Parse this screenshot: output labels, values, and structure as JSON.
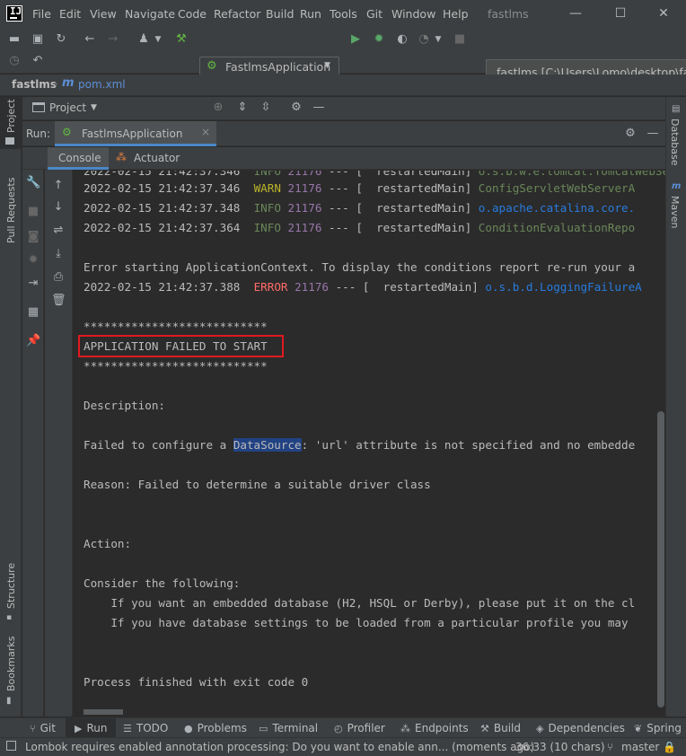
{
  "menubar": {
    "logo": "IJ",
    "items": [
      "File",
      "Edit",
      "View",
      "Navigate",
      "Code",
      "Refactor",
      "Build",
      "Run",
      "Tools",
      "Git",
      "Window",
      "Help"
    ],
    "title": "fastlms"
  },
  "toolbar": {
    "run_config": "FastlmsApplication",
    "tooltip": "fastlms [C:\\Users\\Lomo\\desktop\\fastlms"
  },
  "breadcrumb": {
    "project": "fastlms",
    "file_icon": "m",
    "file": "pom.xml"
  },
  "left_stripe": {
    "project": "Project",
    "pull_requests": "Pull Requests",
    "structure": "Structure",
    "bookmarks": "Bookmarks"
  },
  "right_stripe": {
    "database": "Database",
    "maven": "Maven"
  },
  "project_panel": {
    "label": "Project"
  },
  "run_panel": {
    "label": "Run:",
    "tab": "FastlmsApplication",
    "close": "×",
    "console_tab": "Console",
    "actuator_tab": "Actuator"
  },
  "console": {
    "partial_line": {
      "ts": "2022-02-15 21:42:37.346",
      "level": " INFO ",
      "pid": "21176",
      "sep": " --- [  restartedMain] ",
      "logger": "o.s.b.w.e.tomcat.TomcatWebServer"
    },
    "log_lines": [
      {
        "ts": "2022-02-15 21:42:37.346",
        "level": " WARN ",
        "pid": "21176",
        "sep": " --- [  restartedMain] ",
        "logger": "ConfigServletWebServerA"
      },
      {
        "ts": "2022-02-15 21:42:37.348",
        "level": " INFO ",
        "pid": "21176",
        "sep": " --- [  restartedMain] ",
        "logger": "o.apache.catalina.core."
      },
      {
        "ts": "2022-02-15 21:42:37.364",
        "level": " INFO ",
        "pid": "21176",
        "sep": " --- [  restartedMain] ",
        "logger": "ConditionEvaluationRepo"
      }
    ],
    "error_starting": "Error starting ApplicationContext. To display the conditions report re-run your a",
    "error_line": {
      "ts": "2022-02-15 21:42:37.388",
      "level": " ERROR ",
      "pid": "21176",
      "sep": " --- [  restartedMain] ",
      "logger": "o.s.b.d.LoggingFailureA"
    },
    "stars": "***************************",
    "failed": "APPLICATION FAILED TO START",
    "description_label": "Description:",
    "failed_pre": "Failed to configure a ",
    "failed_hl": "DataSource",
    "failed_post": ": 'url' attribute is not specified and no embedde",
    "reason": "Reason: Failed to determine a suitable driver class",
    "action_label": "Action:",
    "consider": "Consider the following:",
    "consider_1": "    If you want an embedded database (H2, HSQL or Derby), please put it on the cl",
    "consider_2": "    If you have database settings to be loaded from a particular profile you may",
    "exit": "Process finished with exit code 0"
  },
  "bottom_tabs": [
    "Git",
    "Run",
    "TODO",
    "Problems",
    "Terminal",
    "Profiler",
    "Endpoints",
    "Build",
    "Dependencies",
    "Spring"
  ],
  "status_bar": {
    "message": "Lombok requires enabled annotation processing: Do you want to enable ann... (moments ago)",
    "position": "36:33 (10 chars)",
    "branch": "master"
  },
  "colors": {
    "warn": "#bbb529",
    "info": "#6a8759",
    "error": "#ff6b68",
    "pid": "#9876aa",
    "link": "#287bde",
    "highlight_box": "#e0191f",
    "selection": "#214283"
  }
}
